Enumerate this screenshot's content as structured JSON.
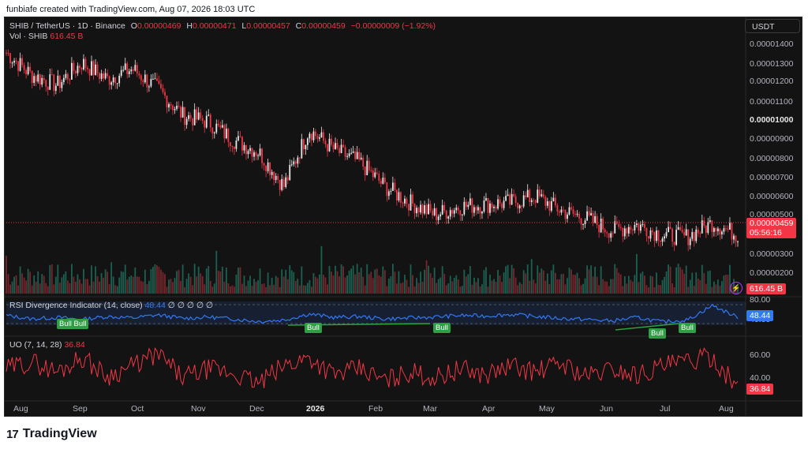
{
  "header": {
    "caption": "funbiafe created with TradingView.com, Aug 07, 2026 18:03 UTC"
  },
  "legend": {
    "symbol": "SHIB / TetherUS · 1D · Binance",
    "o_label": "O",
    "o_val": "0.00000469",
    "h_label": "H",
    "h_val": "0.00000471",
    "l_label": "L",
    "l_val": "0.00000457",
    "c_label": "C",
    "c_val": "0.00000459",
    "change": "−0.00000009 (−1.92%)",
    "vol_label": "Vol · SHIB",
    "vol_val": "616.45 B"
  },
  "currency_button": "USDT",
  "price_axis": {
    "ticks": [
      "0.00001400",
      "0.00001300",
      "0.00001200",
      "0.00001100",
      "0.00001000",
      "0.00000900",
      "0.00000800",
      "0.00000700",
      "0.00000600",
      "0.00000500",
      "0.00000300",
      "0.00000200"
    ],
    "last_price": "0.00000459",
    "countdown": "05:56:16",
    "vol_badge": "616.45 B"
  },
  "rsi": {
    "title": "RSI Divergence Indicator (14, close)",
    "value": "48.44",
    "extra": "∅ ∅ ∅ ∅ ∅",
    "axis_80": "80.00",
    "axis_40": "40.00",
    "bull_labels": [
      "Bull Bull",
      "Bull",
      "Bull",
      "Bull",
      "Bull"
    ]
  },
  "uo": {
    "title": "UO (7, 14, 28)",
    "value": "36.84",
    "axis_60": "60.00",
    "axis_40": "40.00"
  },
  "time_axis": [
    "Aug",
    "Sep",
    "Oct",
    "Nov",
    "Dec",
    "2026",
    "Feb",
    "Mar",
    "Apr",
    "May",
    "Jun",
    "Jul",
    "Aug"
  ],
  "footer": {
    "brand": "TradingView"
  },
  "colors": {
    "up": "#e8e8e8",
    "down": "#f23645",
    "rsi": "#3179f5",
    "uo": "#f23645",
    "bull": "#2f9e44"
  },
  "chart_data": {
    "type": "candlestick",
    "title": "SHIB / TetherUS · 1D · Binance",
    "x": [
      "Aug",
      "Sep",
      "Oct",
      "Nov",
      "Dec",
      "2026",
      "Feb",
      "Mar",
      "Apr",
      "May",
      "Jun",
      "Jul",
      "Aug"
    ],
    "series": [
      {
        "name": "Close",
        "values": [
          1.36e-05,
          1.25e-05,
          1.2e-05,
          1.31e-05,
          1.23e-05,
          1.28e-05,
          1.18e-05,
          1.05e-05,
          1.02e-05,
          9.3e-06,
          8.7e-06,
          7e-06,
          9.8e-06,
          8.8e-06,
          8.2e-06,
          7e-06,
          6.2e-06,
          5.6e-06,
          6e-06,
          6.1e-06,
          6.2e-06,
          6.5e-06,
          5.8e-06,
          5.4e-06,
          4.8e-06,
          5.1e-06,
          4.6e-06,
          4.5e-06,
          5.2e-06,
          4.6e-06
        ]
      },
      {
        "name": "RSI",
        "values": [
          52,
          45,
          48,
          44,
          50,
          47,
          53,
          46,
          49,
          45,
          40,
          43,
          55,
          48,
          50,
          45,
          47,
          49,
          52,
          51,
          54,
          50,
          46,
          44,
          41,
          48,
          39,
          43,
          72,
          48
        ]
      },
      {
        "name": "UO",
        "values": [
          50,
          55,
          48,
          58,
          45,
          52,
          60,
          44,
          50,
          47,
          40,
          52,
          58,
          46,
          50,
          42,
          48,
          44,
          50,
          46,
          52,
          48,
          54,
          45,
          50,
          46,
          52,
          55,
          58,
          37
        ]
      }
    ],
    "ylim": [
      1.7e-06,
      1.48e-05
    ]
  }
}
